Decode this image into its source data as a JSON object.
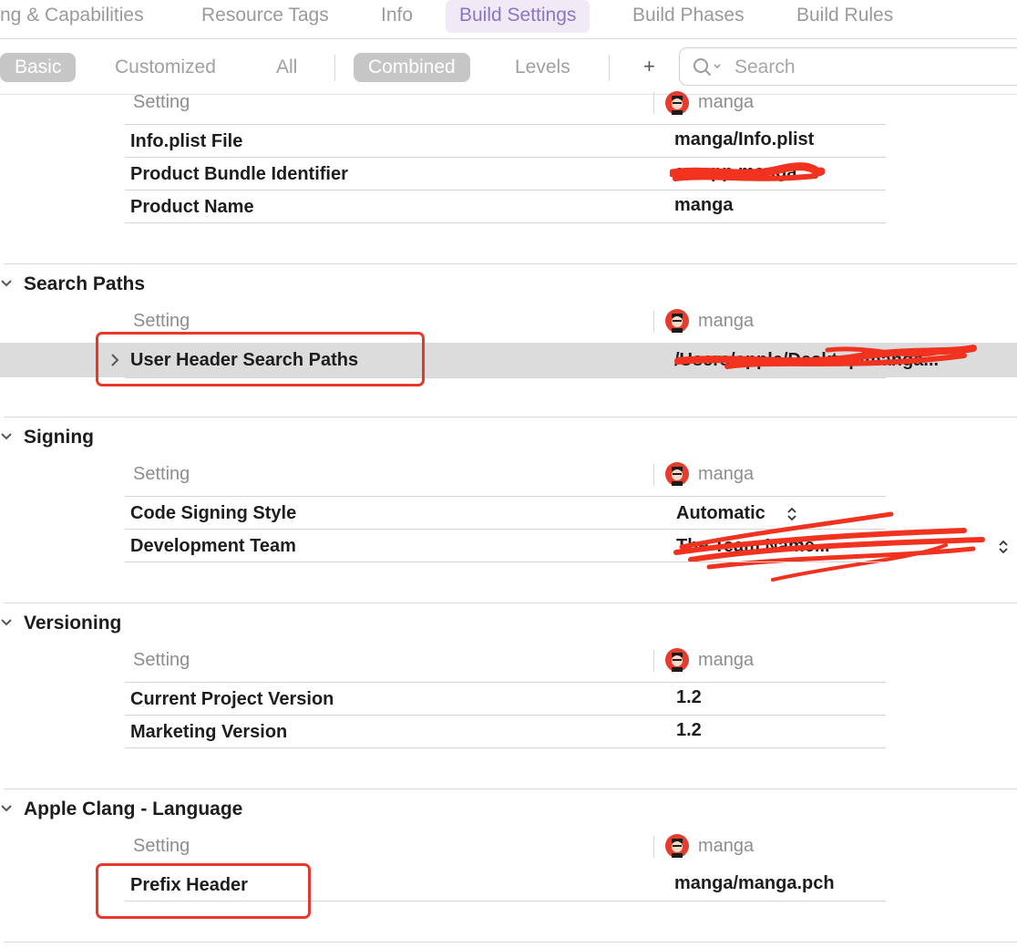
{
  "tabs": [
    {
      "label": "ng & Capabilities",
      "selected": false
    },
    {
      "label": "Resource Tags",
      "selected": false
    },
    {
      "label": "Info",
      "selected": false
    },
    {
      "label": "Build Settings",
      "selected": true
    },
    {
      "label": "Build Phases",
      "selected": false
    },
    {
      "label": "Build Rules",
      "selected": false
    }
  ],
  "filters": {
    "scope": [
      {
        "label": "Basic",
        "selected": true
      },
      {
        "label": "Customized",
        "selected": false
      },
      {
        "label": "All",
        "selected": false
      }
    ],
    "view": [
      {
        "label": "Combined",
        "selected": true
      },
      {
        "label": "Levels",
        "selected": false
      }
    ],
    "add_label": "+",
    "search": {
      "placeholder": "Search",
      "value": ""
    }
  },
  "column_header": {
    "setting": "Setting",
    "target": "manga"
  },
  "sections": [
    {
      "title": "",
      "rows": [
        {
          "label": "Info.plist File",
          "value": "manga/Info.plist"
        },
        {
          "label": "Product Bundle Identifier",
          "value": "cn.app.manga",
          "redacted": true
        },
        {
          "label": "Product Name",
          "value": "manga"
        }
      ]
    },
    {
      "title": "Search Paths",
      "rows": [
        {
          "label": "User Header Search Paths",
          "value": "/Users/apple/Desktop/manga...",
          "redacted": true,
          "selected": true,
          "expandable": true
        }
      ]
    },
    {
      "title": "Signing",
      "rows": [
        {
          "label": "Code Signing Style",
          "value": "Automatic",
          "popup": true
        },
        {
          "label": "Development Team",
          "value": "The Team Name...",
          "redacted": true,
          "popup": true
        }
      ]
    },
    {
      "title": "Versioning",
      "rows": [
        {
          "label": "Current Project Version",
          "value": "1.2"
        },
        {
          "label": "Marketing Version",
          "value": "1.2"
        }
      ]
    },
    {
      "title": "Apple Clang - Language",
      "rows": [
        {
          "label": "Prefix Header",
          "value": "manga/manga.pch"
        }
      ]
    }
  ],
  "colors": {
    "accent": "#8d74c2",
    "selected_tab_bg": "#efeaf6",
    "selected_row_bg": "#dcdcdc",
    "annotation_red": "#e8372c"
  },
  "icons": {
    "search": "magnifier-icon",
    "disclosure": "chevron-down-icon",
    "expand": "chevron-right-icon",
    "popup": "up-down-chevron-icon",
    "target": "avatar-icon"
  }
}
